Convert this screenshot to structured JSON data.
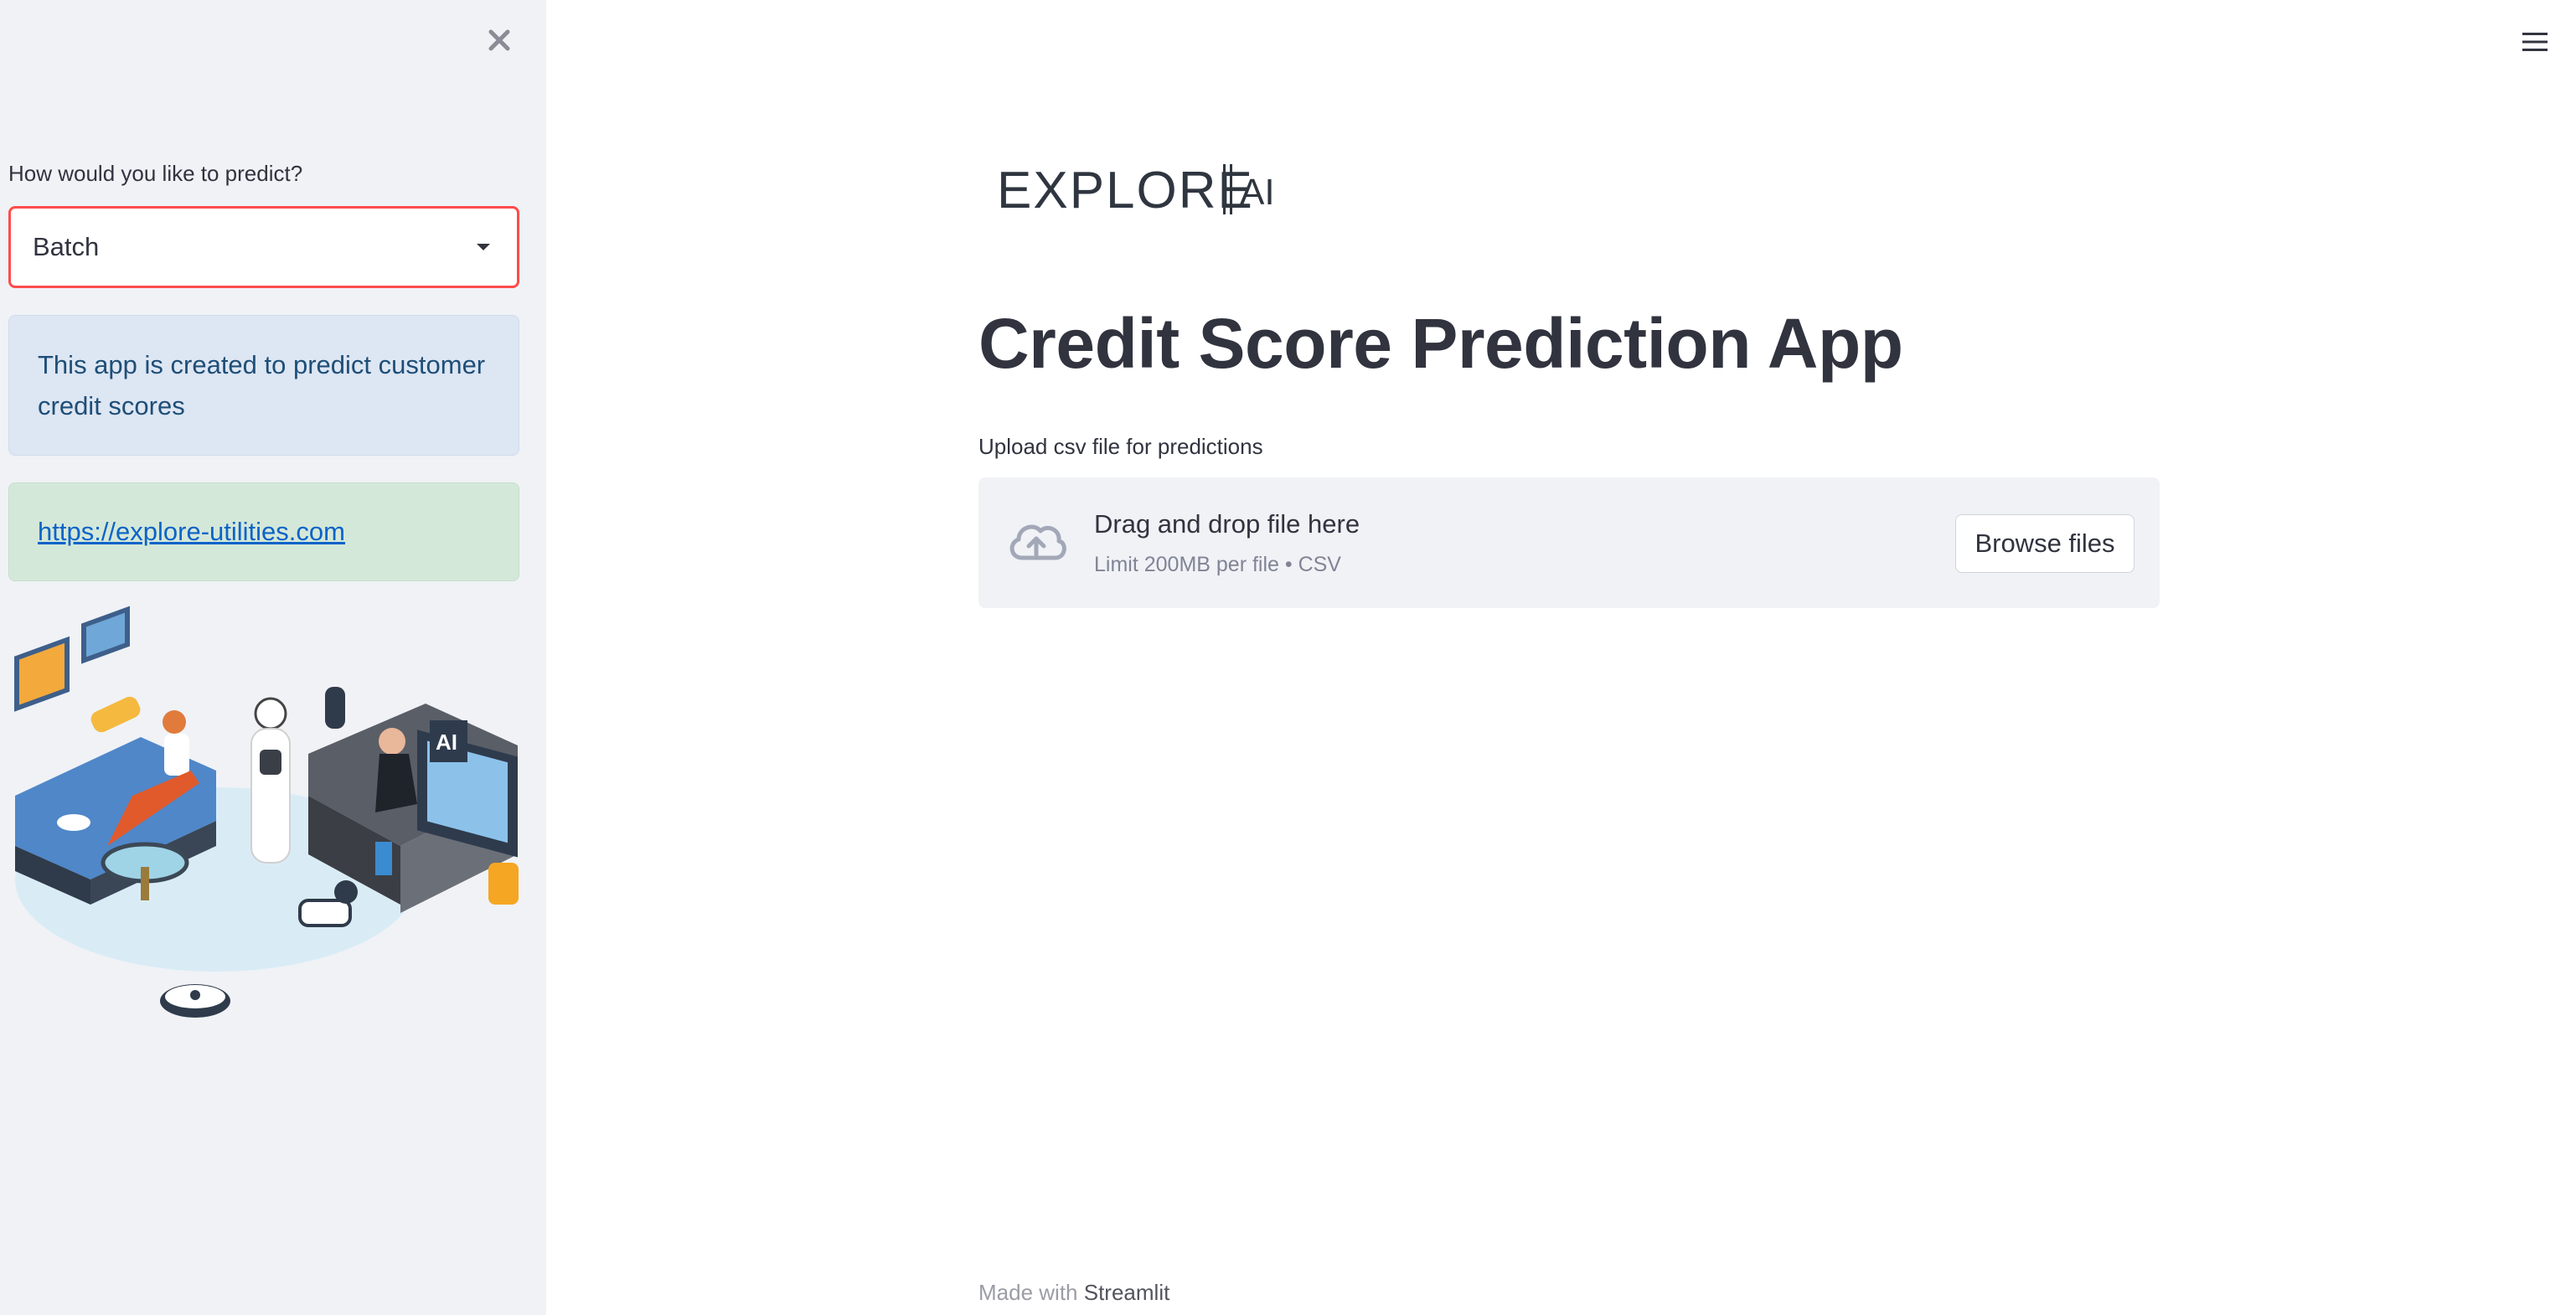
{
  "sidebar": {
    "select_label": "How would you like to predict?",
    "select_value": "Batch",
    "info_text": "This app is created to predict customer credit scores",
    "link_text": "https://explore-utilities.com"
  },
  "main": {
    "logo_text": "EXPLORE",
    "logo_suffix": "AI",
    "title": "Credit Score Prediction App",
    "upload_label": "Upload csv file for predictions",
    "dropzone_title": "Drag and drop file here",
    "dropzone_subtitle": "Limit 200MB per file • CSV",
    "browse_button": "Browse files"
  },
  "footer": {
    "made_with": "Made with",
    "brand": "Streamlit"
  },
  "colors": {
    "accent": "#ff4b4b",
    "sidebar_bg": "#f0f2f6",
    "info_bg": "#dde6f3",
    "success_bg": "#d4e8d9",
    "text": "#31333f"
  },
  "icons": [
    "close-icon",
    "menu-icon",
    "chevron-down-icon",
    "cloud-upload-icon"
  ]
}
